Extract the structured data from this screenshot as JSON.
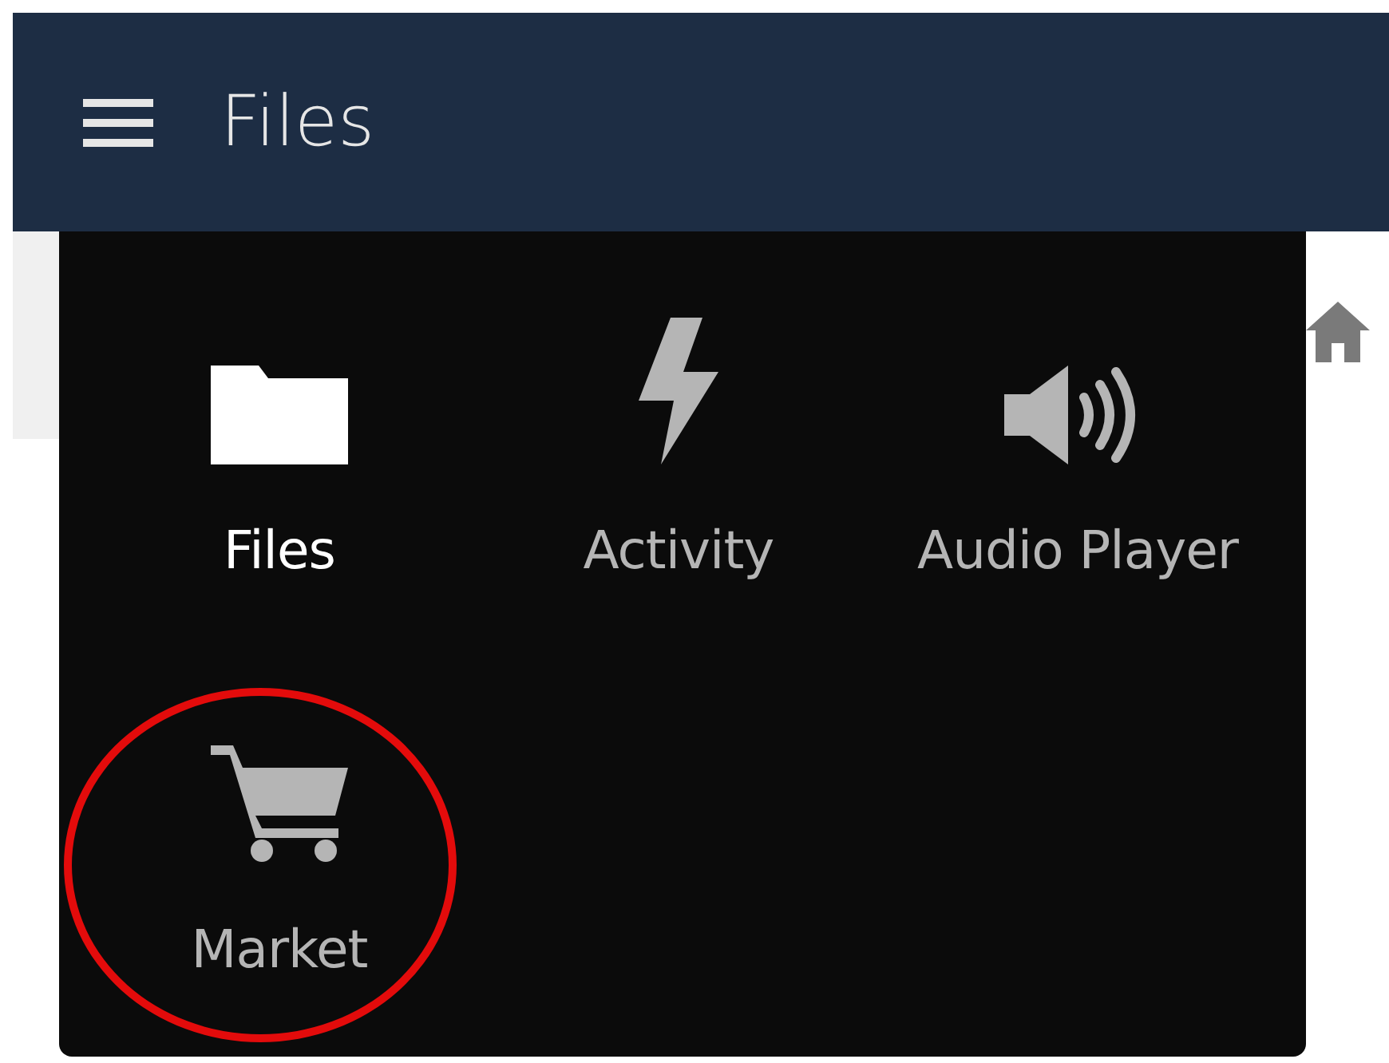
{
  "header": {
    "title": "Files"
  },
  "app_menu": {
    "items": [
      {
        "label": "Files",
        "selected": true,
        "highlighted": false
      },
      {
        "label": "Activity",
        "selected": false,
        "highlighted": false
      },
      {
        "label": "Audio Player",
        "selected": false,
        "highlighted": false
      },
      {
        "label": "Market",
        "selected": false,
        "highlighted": true
      }
    ]
  }
}
